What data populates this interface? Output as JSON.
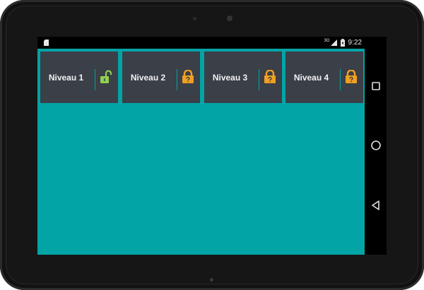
{
  "status_bar": {
    "network": "3G",
    "time": "9:22"
  },
  "levels": [
    {
      "label": "Niveau 1",
      "state": "unlocked",
      "lock_color": "#8fd04f"
    },
    {
      "label": "Niveau 2",
      "state": "locked",
      "lock_color": "#f0a020"
    },
    {
      "label": "Niveau 3",
      "state": "locked",
      "lock_color": "#f0a020"
    },
    {
      "label": "Niveau 4",
      "state": "locked",
      "lock_color": "#f0a020"
    }
  ],
  "nav": {
    "recent": "square-icon",
    "home": "circle-icon",
    "back": "triangle-icon"
  },
  "colors": {
    "background": "#02a4a6",
    "tile": "#3a3f48"
  }
}
